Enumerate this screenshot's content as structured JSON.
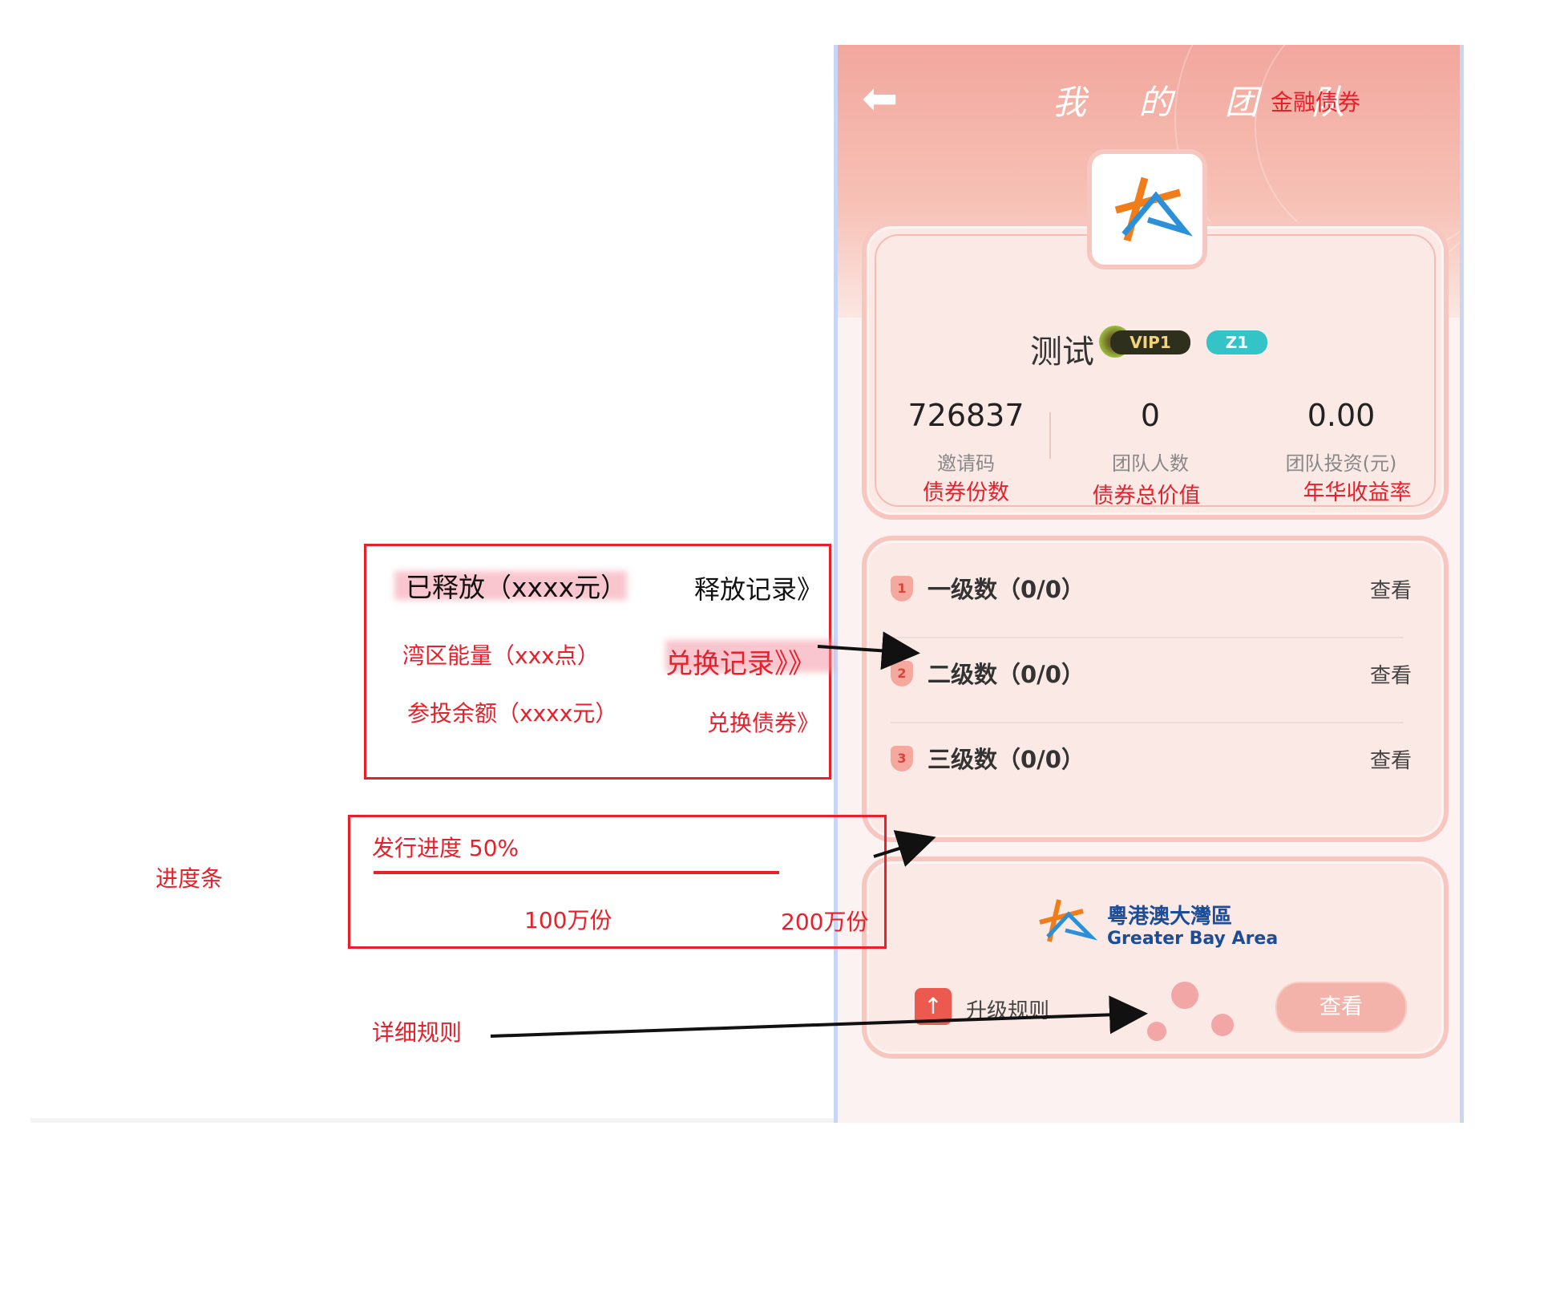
{
  "phone": {
    "title": "我 的 团 队",
    "title_note": "金融债券",
    "user_name": "测试",
    "badges": {
      "vip": "VIP1",
      "zone": "Z1"
    },
    "stats": [
      {
        "value": "726837",
        "label": "邀请码",
        "note": "债券份数"
      },
      {
        "value": "0",
        "label": "团队人数",
        "note": "债券总价值"
      },
      {
        "value": "0.00",
        "label": "团队投资(元)",
        "note": "年华收益率"
      }
    ],
    "levels": [
      {
        "num": "1",
        "label": "一级数（0/0）",
        "action": "查看"
      },
      {
        "num": "2",
        "label": "二级数（0/0）",
        "action": "查看"
      },
      {
        "num": "3",
        "label": "三级数（0/0）",
        "action": "查看"
      }
    ],
    "gba": {
      "cn": "粵港澳大灣區",
      "en": "Greater Bay Area"
    },
    "rule": {
      "label": "升级规则",
      "action": "查看"
    }
  },
  "release_box": {
    "released": "已释放（xxxx元）",
    "release_record": "释放记录》",
    "bay_energy": "湾区能量（xxx点）",
    "exchange_record": "兑换记录》》",
    "balance": "参投余额（xxxx元）",
    "exchange_bond": "兑换债券》"
  },
  "progress_box": {
    "label": "发行进度 50%",
    "progress_fraction": 0.5,
    "current": "100万份",
    "total": "200万份"
  },
  "side_labels": {
    "progress_bar": "进度条",
    "detailed_rules": "详细规则"
  },
  "colors": {
    "annotation_red": "#e8202a",
    "header_pink": "#f2a79d",
    "card_border": "#f6c6bf",
    "badge_z1": "#34c3c6",
    "gba_blue": "#1b4d99"
  }
}
